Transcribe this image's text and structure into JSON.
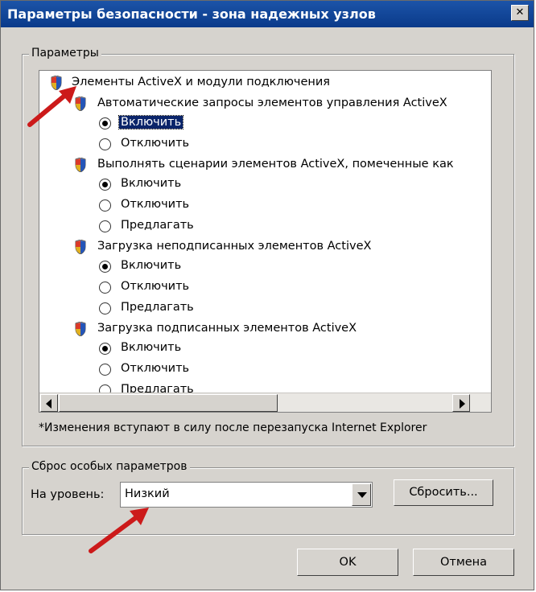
{
  "window": {
    "title": "Параметры безопасности - зона надежных узлов",
    "close_glyph": "✕"
  },
  "settings_group": {
    "label": "Параметры",
    "root": "Элементы ActiveX и модули подключения",
    "items": [
      {
        "title": "Автоматические запросы элементов управления ActiveX",
        "options": [
          {
            "label": "Включить",
            "checked": true,
            "selected": true
          },
          {
            "label": "Отключить",
            "checked": false
          }
        ]
      },
      {
        "title": "Выполнять сценарии элементов ActiveX, помеченные как",
        "options": [
          {
            "label": "Включить",
            "checked": true
          },
          {
            "label": "Отключить",
            "checked": false
          },
          {
            "label": "Предлагать",
            "checked": false
          }
        ]
      },
      {
        "title": "Загрузка неподписанных элементов ActiveX",
        "options": [
          {
            "label": "Включить",
            "checked": true
          },
          {
            "label": "Отключить",
            "checked": false
          },
          {
            "label": "Предлагать",
            "checked": false
          }
        ]
      },
      {
        "title": "Загрузка подписанных элементов ActiveX",
        "options": [
          {
            "label": "Включить",
            "checked": true
          },
          {
            "label": "Отключить",
            "checked": false
          },
          {
            "label": "Предлагать",
            "checked": false
          }
        ]
      }
    ],
    "note": "*Изменения вступают в силу после перезапуска Internet Explorer"
  },
  "reset_group": {
    "label": "Сброс особых параметров",
    "level_label": "На уровень:",
    "level_value": "Низкий",
    "reset_button": "Сбросить..."
  },
  "buttons": {
    "ok": "OK",
    "cancel": "Отмена"
  },
  "colors": {
    "title_bar": "#0a3a8a",
    "selection": "#0a246a",
    "annotation_arrow": "#cc1a1a"
  }
}
